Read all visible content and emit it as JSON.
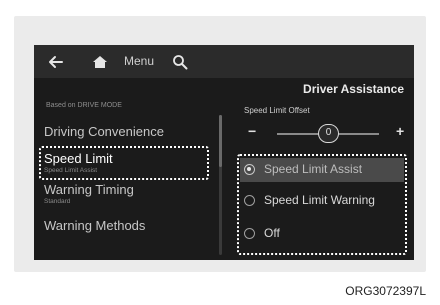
{
  "topbar": {
    "menu_label": "Menu"
  },
  "icons": {
    "back": "back-arrow-icon",
    "home": "home-icon",
    "search": "search-icon"
  },
  "right_panel": {
    "title": "Driver Assistance",
    "offset_label": "Speed Limit Offset",
    "minus": "−",
    "plus": "+",
    "slider_value_label": "0",
    "slider_position": 0.5,
    "options": [
      {
        "label": "Speed Limit Assist",
        "selected": true
      },
      {
        "label": "Speed Limit Warning",
        "selected": false
      },
      {
        "label": "Off",
        "selected": false
      }
    ]
  },
  "left_panel": {
    "caption": "Based on DRIVE MODE",
    "items": [
      {
        "label": "Driving Convenience",
        "sub": ""
      },
      {
        "label": "Speed Limit",
        "sub": "Speed Limit Assist"
      },
      {
        "label": "Warning Timing",
        "sub": "Standard"
      },
      {
        "label": "Warning Methods",
        "sub": ""
      }
    ]
  },
  "figure_code": "ORG3072397L",
  "colors": {
    "screen_bg": "#1b1b1b",
    "topbar_bg": "#2b2b2b",
    "highlight_outline": "#ffffff",
    "selected_row_bg": "#4a4a4a"
  }
}
